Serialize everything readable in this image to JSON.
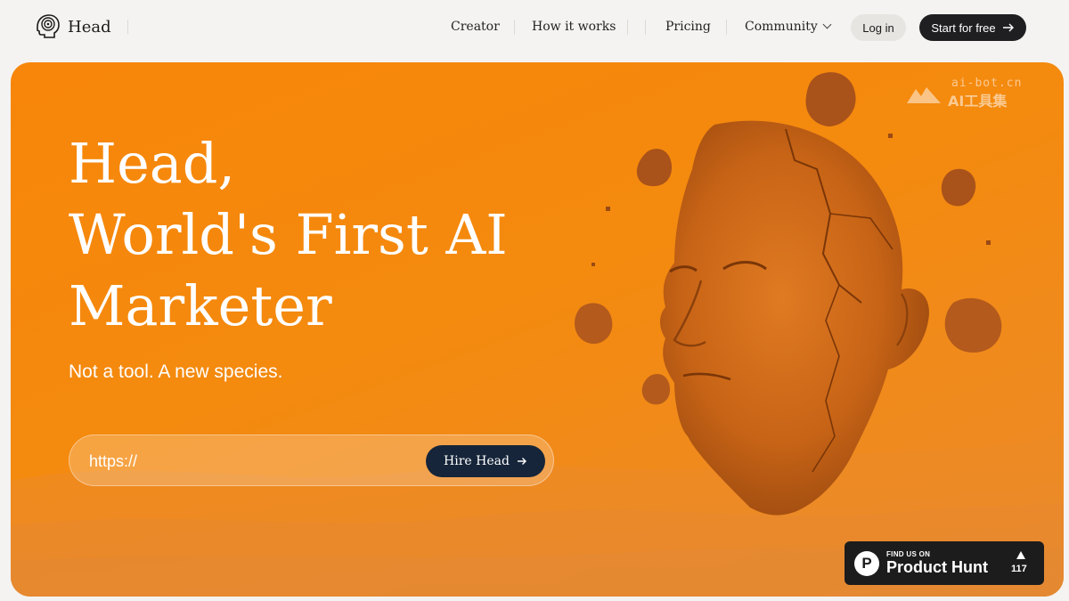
{
  "brand": {
    "name": "Head",
    "logo_icon": "head-profile-icon"
  },
  "nav": {
    "links": [
      {
        "label": "Creator"
      },
      {
        "label": "How it works"
      },
      {
        "label": "Pricing"
      },
      {
        "label": "Community"
      }
    ],
    "login_label": "Log in",
    "start_label": "Start for free",
    "start_icon": "arrow-right-icon"
  },
  "hero": {
    "headline": [
      "Head,",
      "World's First AI",
      "Marketer"
    ],
    "subheadline": "Not a tool. A new species.",
    "url_placeholder": "https://",
    "cta_label": "Hire Head",
    "cta_icon": "arrow-right-icon",
    "background_color": "#f58a10",
    "image": "floating-head-sculpture"
  },
  "watermark": {
    "line1": "ai-bot.cn",
    "line2": "AI工具集"
  },
  "product_hunt": {
    "small_label": "FIND US ON",
    "big_label": "Product Hunt",
    "votes": "117",
    "logo_letter": "P"
  }
}
